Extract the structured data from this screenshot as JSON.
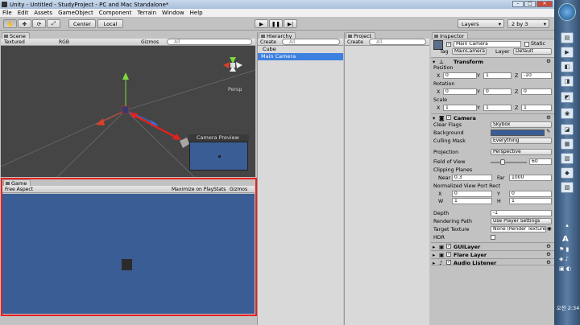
{
  "window": {
    "title": "Unity - Untitled - StudyProject - PC and Mac Standalone*"
  },
  "menu": [
    "File",
    "Edit",
    "Assets",
    "GameObject",
    "Component",
    "Terrain",
    "Window",
    "Help"
  ],
  "toolbar": {
    "center": "Center",
    "local": "Local",
    "layers": "Layers",
    "layout": "2 by 3"
  },
  "scene": {
    "tab": "Scene",
    "shading": "Textured",
    "render_mode": "RGB",
    "gizmos": "Gizmos",
    "search_placeholder": "All",
    "persp": "Persp",
    "camera_preview": "Camera Preview"
  },
  "game": {
    "tab": "Game",
    "aspect": "Free Aspect",
    "maximize": "Maximize on Play",
    "stats": "Stats",
    "gizmos": "Gizmos",
    "bg_color": "#3b5d95"
  },
  "hierarchy": {
    "tab": "Hierarchy",
    "create": "Create",
    "search_placeholder": "All",
    "items": [
      "Cube",
      "Main Camera"
    ],
    "selected": "Main Camera"
  },
  "project": {
    "tab": "Project",
    "create": "Create",
    "search_placeholder": "All"
  },
  "inspector": {
    "tab": "Inspector",
    "object_name": "Main Camera",
    "static_label": "Static",
    "tag_label": "Tag",
    "tag": "MainCamera",
    "layer_label": "Layer",
    "layer": "Default",
    "transform": {
      "title": "Transform",
      "position_label": "Position",
      "rotation_label": "Rotation",
      "scale_label": "Scale",
      "position": [
        "0",
        "1",
        "-10"
      ],
      "rotation": [
        "0",
        "0",
        "0"
      ],
      "scale": [
        "1",
        "1",
        "1"
      ]
    },
    "camera": {
      "title": "Camera",
      "clear_flags_label": "Clear Flags",
      "clear_flags": "Skybox",
      "background_label": "Background",
      "background_color": "#3b5d95",
      "culling_mask_label": "Culling Mask",
      "culling_mask": "Everything",
      "projection_label": "Projection",
      "projection": "Perspective",
      "fov_label": "Field of View",
      "fov": "60",
      "fov_fraction": 0.33,
      "clipping_label": "Clipping Planes",
      "near_label": "Near",
      "near": "0.3",
      "far_label": "Far",
      "far": "1000",
      "viewport_label": "Normalized View Port Rect",
      "vx": "0",
      "vy": "0",
      "vw": "1",
      "vh": "1",
      "depth_label": "Depth",
      "depth": "-1",
      "rendering_path_label": "Rendering Path",
      "rendering_path": "Use Player Settings",
      "target_texture_label": "Target Texture",
      "target_texture": "None (Render Texture)",
      "hdr_label": "HDR"
    },
    "components": [
      "GUILayer",
      "Flare Layer",
      "Audio Listener"
    ]
  },
  "taskbar": {
    "ime": "A",
    "clock": "오전 2:34"
  }
}
